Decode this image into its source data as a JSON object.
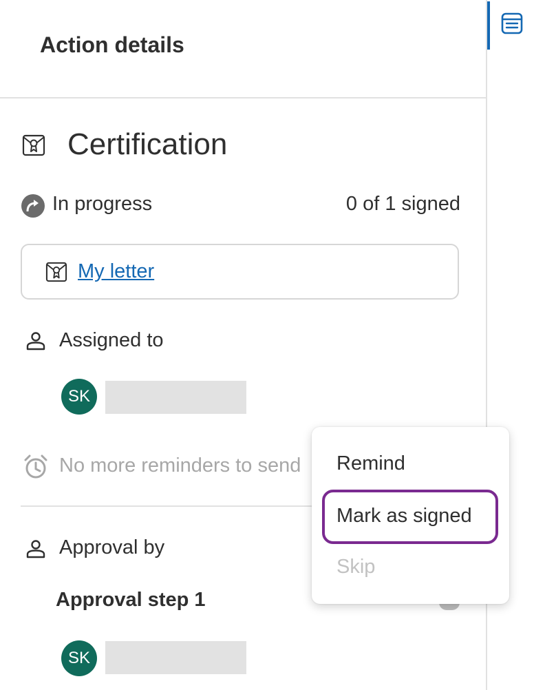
{
  "header": {
    "title": "Action details"
  },
  "action": {
    "title": "Certification",
    "status": "In progress",
    "signed_count": "0 of 1 signed",
    "document_link": "My letter"
  },
  "assigned": {
    "label": "Assigned to",
    "assignee_initials": "SK",
    "reminder_text": "No more reminders to send"
  },
  "approval": {
    "label": "Approval by",
    "step_title": "Approval step 1",
    "approver_initials": "SK"
  },
  "menu": {
    "items": [
      {
        "label": "Remind"
      },
      {
        "label": "Mark as signed"
      },
      {
        "label": "Skip"
      }
    ]
  },
  "colors": {
    "accent": "#1468b3",
    "avatar": "#106b5b",
    "highlight": "#7a2a90",
    "muted_text": "#a7a7a7"
  },
  "icons": [
    "certificate-icon",
    "in-progress-arrow-icon",
    "user-icon",
    "alarm-clock-icon",
    "details-list-icon"
  ]
}
